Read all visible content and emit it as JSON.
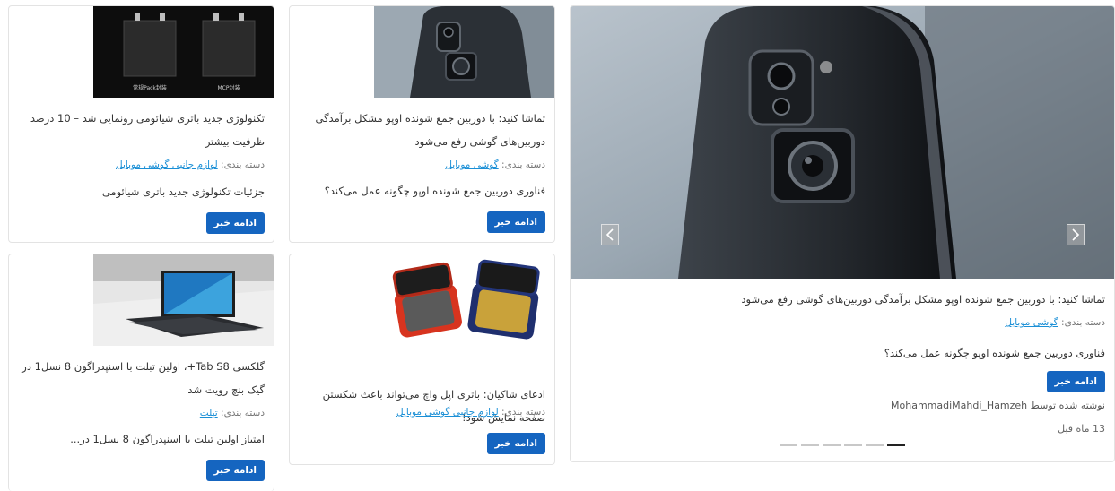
{
  "featured": {
    "title": "تماشا کنید: با دوربین جمع شونده اوپو مشکل برآمدگی دوربین‌های گوشی رفع می‌شود",
    "category_prefix": "دسته بندی:",
    "category": "گوشی موبایل",
    "excerpt": "فناوری دوربین جمع شونده اوپو چگونه عمل می‌کند؟",
    "button": "ادامه خبر",
    "author": "نوشته شده توسط MohammadiMahdi_Hamzeh",
    "time": "13 ماه قبل",
    "slides_count": 6,
    "active_slide": 6,
    "prev_icon": "chevron-left-icon",
    "next_icon": "chevron-right-icon"
  },
  "cards": [
    {
      "title": "تماشا کنید: با دوربین جمع شونده اوپو مشکل برآمدگی دوربین‌های گوشی رفع می‌شود",
      "category_prefix": "دسته بندی:",
      "category": "گوشی موبایل",
      "excerpt": "فناوری دوربین جمع شونده اوپو چگونه عمل می‌کند؟",
      "button": "ادامه خبر"
    },
    {
      "title": "تکنولوژی جدید باتری شیائومی رونمایی شد – 10 درصد ظرفیت بیشتر",
      "category_prefix": "دسته بندی:",
      "category": "لوازم جانبی گوشی موبایل",
      "excerpt": "جزئیات تکنولوژی جدید باتری شیائومی",
      "button": "ادامه خبر",
      "image_labels": [
        "常规Pack封装",
        "MCP封装"
      ]
    },
    {
      "title": "ادعای شاکیان: باتری اپل واچ می‌تواند باعث شکستن صفحه نمایش شود!",
      "category_prefix": "دسته بندی:",
      "category": "لوازم جانبی گوشی موبایل",
      "button": "ادامه خبر"
    },
    {
      "title": "گلکسی Tab S8+، اولین تبلت با اسنپدراگون 8 نسل1 در گیک بنچ رویت شد",
      "category_prefix": "دسته بندی:",
      "category": "تبلت",
      "excerpt": "امتیاز اولین تبلت با اسنپدراگون 8 نسل1 در...",
      "button": "ادامه خبر"
    }
  ],
  "colors": {
    "button": "#1565c0",
    "link": "#1a8fd6",
    "border": "#e3e3e3"
  }
}
